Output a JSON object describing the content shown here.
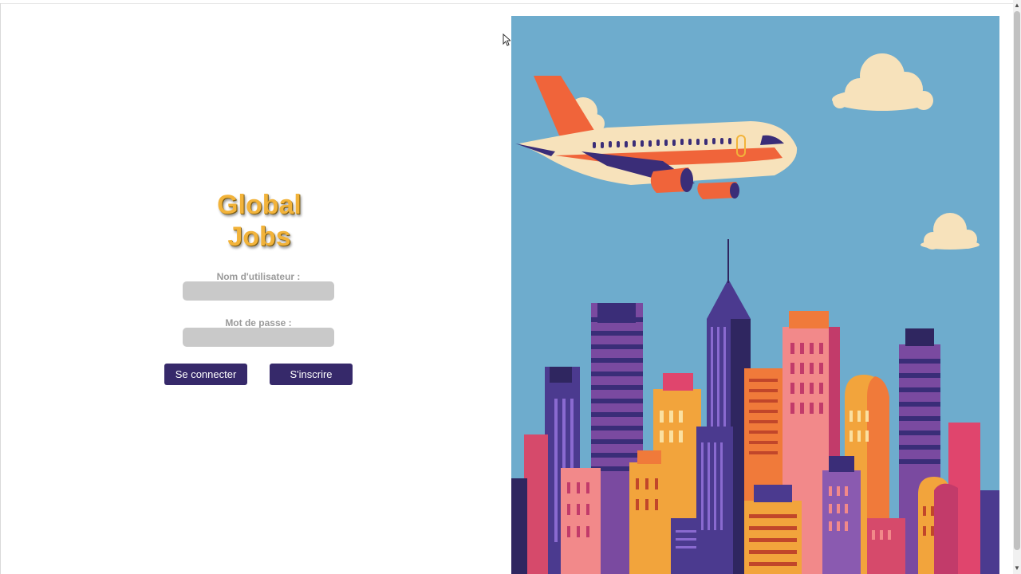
{
  "brand": {
    "line1": "Global",
    "line2": "Jobs"
  },
  "login_form": {
    "username_label": "Nom d'utilisateur :",
    "username_value": "",
    "password_label": "Mot de passe :",
    "password_value": "",
    "login_button": "Se connecter",
    "signup_button": "S'inscrire"
  },
  "hero_image": {
    "subject": "airplane-over-city-skyline"
  },
  "colors": {
    "brand_text": "#f2b33a",
    "button_bg": "#36296a",
    "input_bg": "#c9c9c9",
    "sky": "#6eaccd"
  }
}
